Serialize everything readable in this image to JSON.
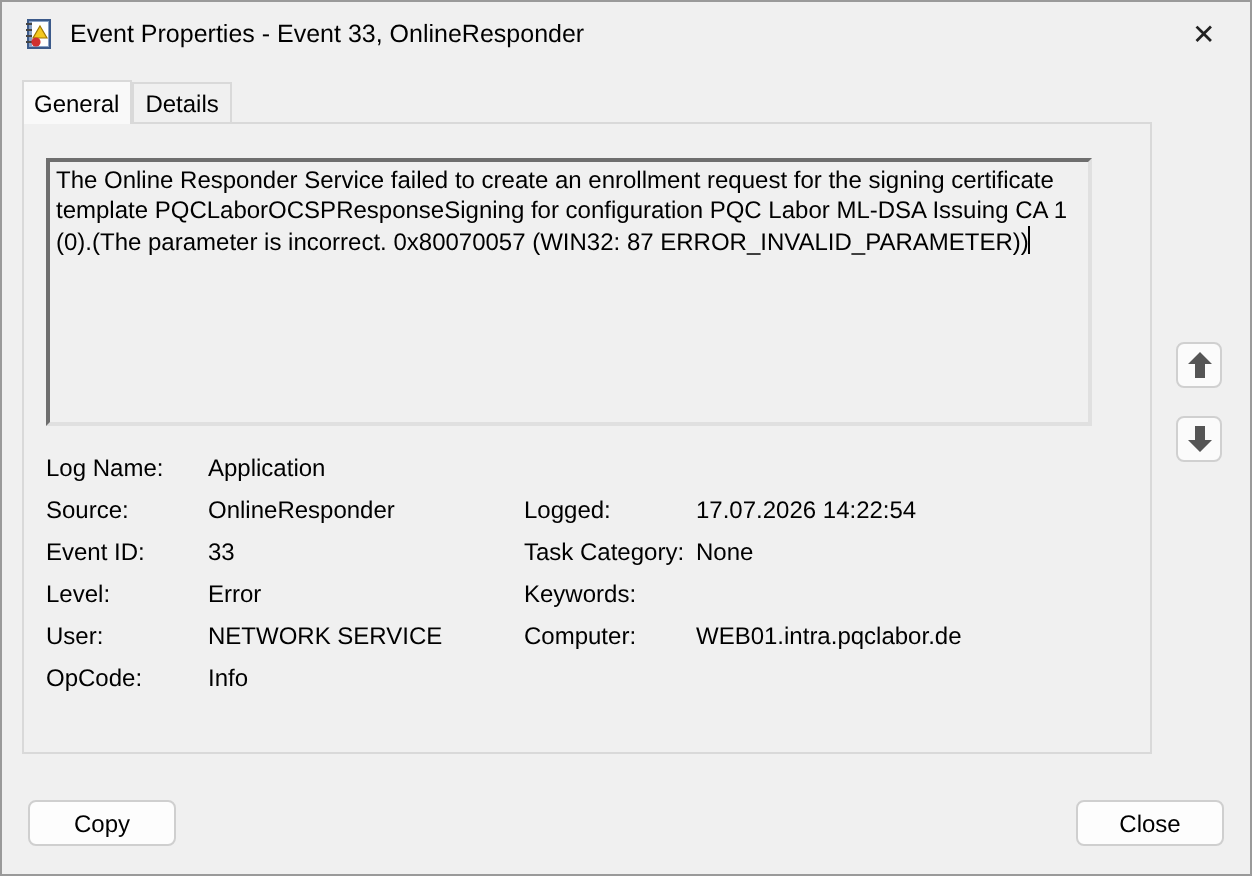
{
  "window": {
    "title": "Event Properties - Event 33, OnlineResponder",
    "close": "✕"
  },
  "tabs": [
    {
      "label": "General",
      "selected": true
    },
    {
      "label": "Details",
      "selected": false
    }
  ],
  "description": "The Online Responder Service failed to create an enrollment request for the signing certificate template PQCLaborOCSPResponseSigning for configuration PQC Labor ML-DSA Issuing CA 1 (0).(The parameter is incorrect. 0x80070057 (WIN32: 87 ERROR_INVALID_PARAMETER))",
  "left_fields": [
    {
      "label": "Log Name:",
      "value": "Application"
    },
    {
      "label": "Source:",
      "value": "OnlineResponder"
    },
    {
      "label": "Event ID:",
      "value": "33"
    },
    {
      "label": "Level:",
      "value": "Error"
    },
    {
      "label": "User:",
      "value": "NETWORK SERVICE"
    },
    {
      "label": "OpCode:",
      "value": "Info"
    }
  ],
  "right_fields": [
    {
      "label": "Logged:",
      "value": "17.07.2026 14:22:54"
    },
    {
      "label": "Task Category:",
      "value": "None"
    },
    {
      "label": "Keywords:"
    },
    {
      "label": "Computer:",
      "value": "WEB01.intra.pqclabor.de"
    }
  ],
  "buttons": [
    {
      "label": "Copy"
    },
    {
      "label": "Close"
    }
  ]
}
